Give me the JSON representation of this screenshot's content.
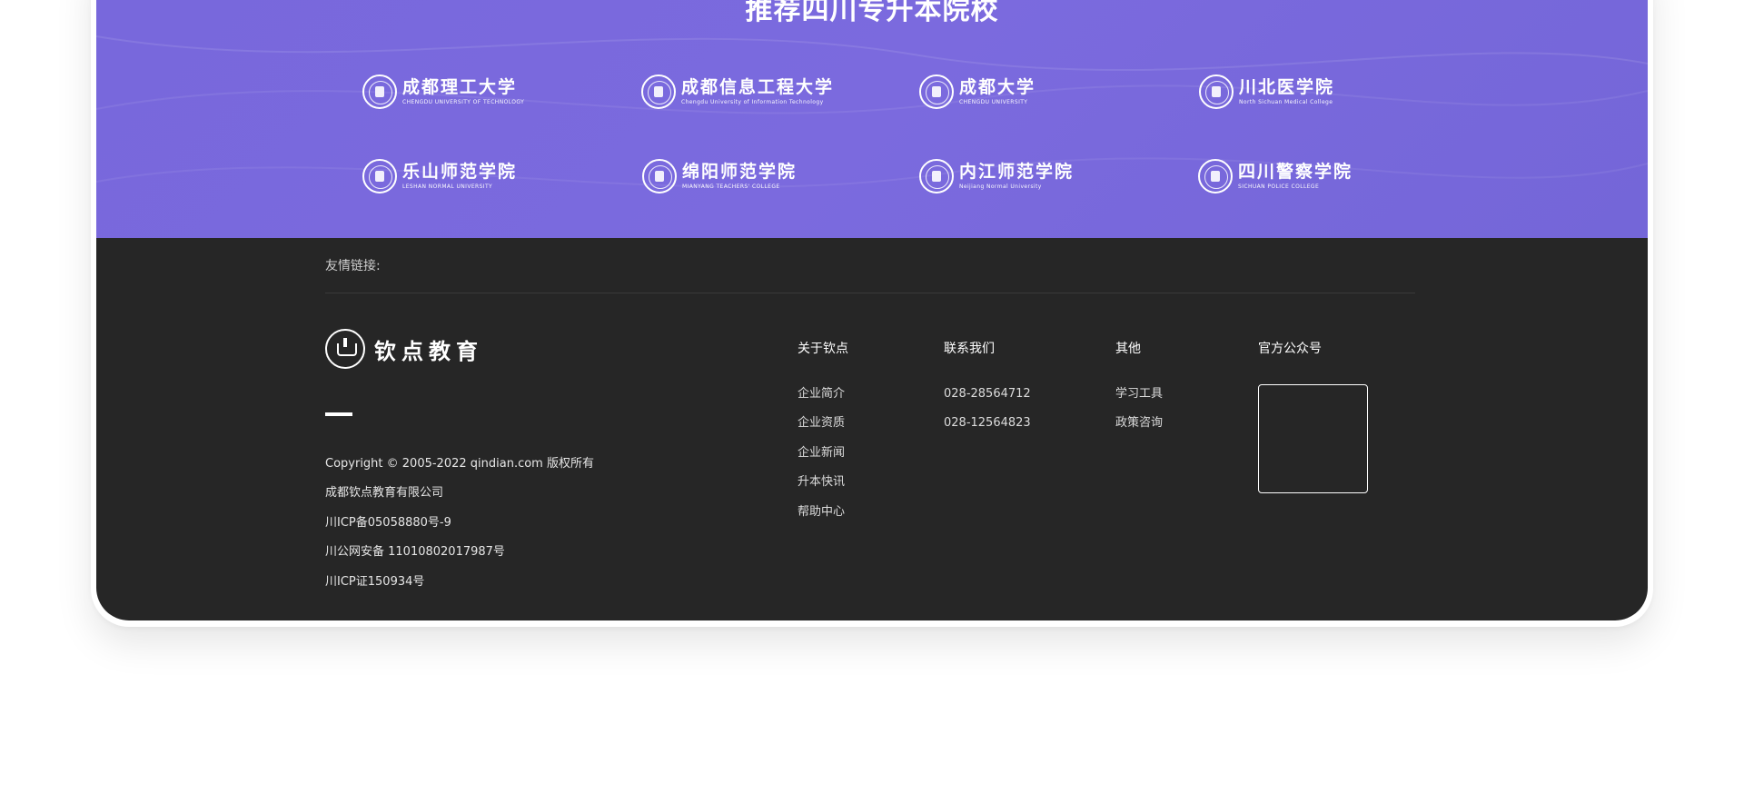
{
  "banner": {
    "title": "推荐四川专升本院校",
    "schools": [
      {
        "cn": "成都理工大学",
        "en": "CHENGDU UNIVERSITY OF TECHNOLOGY"
      },
      {
        "cn": "成都信息工程大学",
        "en": "Chengdu University of Information Technology"
      },
      {
        "cn": "成都大学",
        "en": "CHENGDU UNIVERSITY"
      },
      {
        "cn": "川北医学院",
        "en": "North Sichuan Medical College"
      },
      {
        "cn": "乐山师范学院",
        "en": "LESHAN NORMAL UNIVERSITY"
      },
      {
        "cn": "绵阳师范学院",
        "en": "MIANYANG TEACHERS' COLLEGE"
      },
      {
        "cn": "内江师范学院",
        "en": "Neijiang  Normal  University"
      },
      {
        "cn": "四川警察学院",
        "en": "SICHUAN POLICE COLLEGE"
      }
    ]
  },
  "footer": {
    "friend_links_label": "友情链接:",
    "brand_name": "钦点教育",
    "info": [
      "Copyright © 2005-2022 qindian.com 版权所有",
      "成都钦点教育有限公司",
      "川ICP备05058880号-9",
      "川公网安备 110108020179​87号",
      "川ICP证150934号"
    ],
    "columns": [
      {
        "title": "关于钦点",
        "items": [
          "企业简介",
          "企业资质",
          "企业新闻",
          "升本快讯",
          "帮助中心"
        ]
      },
      {
        "title": "联系我们",
        "items": [
          "028-28564712",
          "028-12564823"
        ]
      },
      {
        "title": "其他",
        "items": [
          "学习工具",
          "政策咨询"
        ]
      },
      {
        "title": "官方公众号",
        "items": []
      }
    ]
  }
}
